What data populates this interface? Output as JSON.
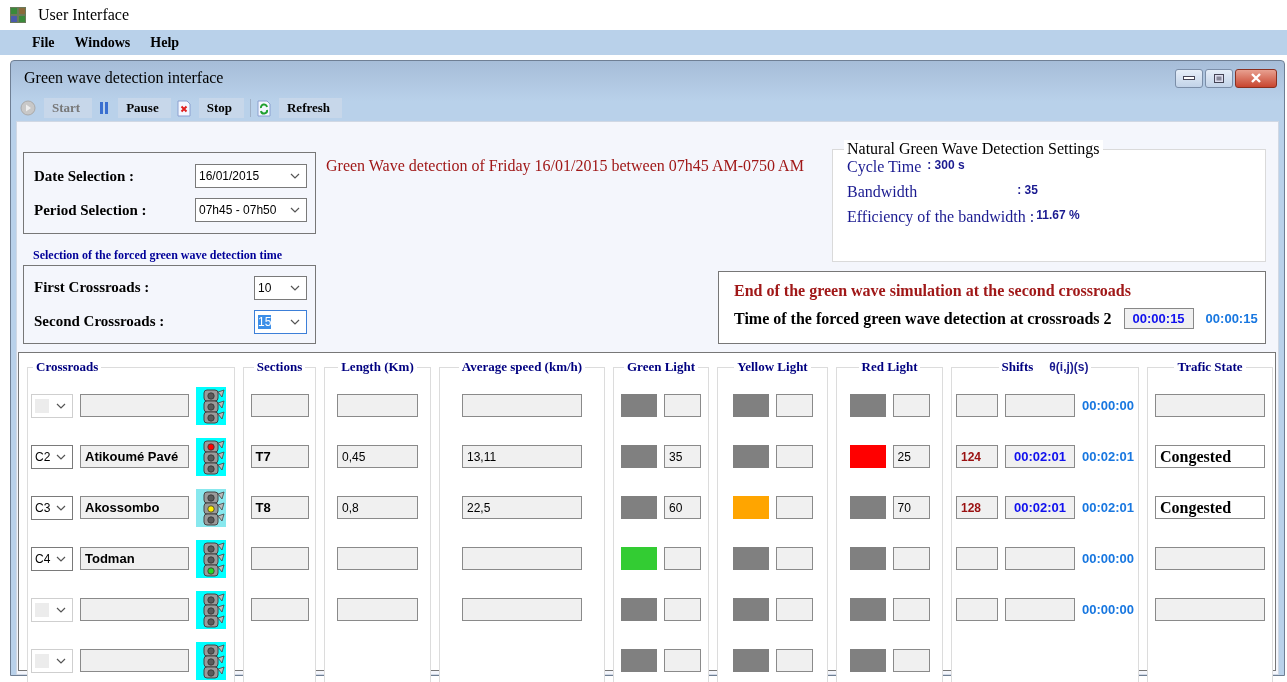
{
  "app": {
    "title": "User Interface"
  },
  "menu": [
    "File",
    "Windows",
    "Help"
  ],
  "child_window": {
    "title": "Green wave detection interface"
  },
  "toolbar": [
    {
      "label": "Start",
      "kind": "start",
      "disabled": true
    },
    {
      "label": "Pause",
      "kind": "pause",
      "disabled": false
    },
    {
      "label": "Stop",
      "kind": "stop",
      "disabled": false
    },
    {
      "label": "Refresh",
      "kind": "refresh",
      "disabled": false
    }
  ],
  "selection": {
    "fields": [
      {
        "label": "Date Selection :",
        "value": "16/01/2015"
      },
      {
        "label": "Period Selection :",
        "value": "07h45 - 07h50"
      }
    ]
  },
  "forced": {
    "title": "Selection of the forced green wave detection time",
    "fields": [
      {
        "label": "First Crossroads :",
        "value": "10",
        "focused": false
      },
      {
        "label": "Second Crossroads :",
        "value": "15",
        "focused": true
      }
    ]
  },
  "headline": "Green Wave detection of Friday 16/01/2015 between 07h45 AM-0750 AM",
  "settings": {
    "title": "Natural Green Wave Detection Settings",
    "rows": [
      {
        "label": "Cycle Time",
        "value": ": 300 s"
      },
      {
        "label": "Bandwidth",
        "value": ": 35"
      },
      {
        "label": "Efficiency of the bandwidth :",
        "value": "11.67 %"
      }
    ]
  },
  "simulation_end": {
    "title": "End of the green wave simulation at the second crossroads",
    "label": "Time of the forced green wave detection at crossroads 2",
    "value": "00:00:15",
    "reading": "00:00:15"
  },
  "table": {
    "columns": [
      {
        "kind": "crossroads",
        "label": "Crossroads",
        "cells": [
          {
            "enabled": false,
            "kind": "dark"
          },
          {
            "enabled": true,
            "code": "C2",
            "name": "Atikoumé Pavé",
            "kind": "red"
          },
          {
            "enabled": true,
            "code": "C3",
            "name": "Akossombo",
            "kind": "yellow"
          },
          {
            "enabled": true,
            "code": "C4",
            "name": "Todman",
            "kind": "green"
          },
          {
            "enabled": false,
            "kind": "dark"
          },
          {
            "enabled": false,
            "kind": "dark"
          }
        ]
      },
      {
        "kind": "text",
        "label": "Sections",
        "bold": true,
        "cells": [
          {},
          {
            "value": "T7"
          },
          {
            "value": "T8"
          },
          {},
          {}
        ]
      },
      {
        "kind": "text",
        "label": "Length (Km)",
        "bold": false,
        "cells": [
          {},
          {
            "value": "0,45"
          },
          {
            "value": "0,8"
          },
          {},
          {}
        ]
      },
      {
        "kind": "text",
        "label": "Average speed (km/h)",
        "bold": false,
        "cells": [
          {},
          {
            "value": "13,11"
          },
          {
            "value": "22,5"
          },
          {},
          {}
        ]
      },
      {
        "kind": "light",
        "label": "Green Light",
        "color": "#33cc33",
        "cells": [
          {
            "on": false
          },
          {
            "on": false,
            "value": "35"
          },
          {
            "on": false,
            "value": "60"
          },
          {
            "on": true
          },
          {
            "on": false
          },
          {
            "on": false
          }
        ]
      },
      {
        "kind": "light",
        "label": "Yellow Light",
        "color": "#ffa500",
        "cells": [
          {
            "on": false
          },
          {
            "on": false
          },
          {
            "on": true
          },
          {
            "on": false
          },
          {
            "on": false
          },
          {
            "on": false
          }
        ]
      },
      {
        "kind": "light",
        "label": "Red Light",
        "color": "#ff0000",
        "cells": [
          {
            "on": false
          },
          {
            "on": true,
            "value": "25"
          },
          {
            "on": false,
            "value": "70"
          },
          {
            "on": false
          },
          {
            "on": false
          },
          {
            "on": false
          }
        ]
      },
      {
        "kind": "shift",
        "label": "Shifts",
        "sub": "θ(i,j)(s)",
        "cells": [
          {
            "reading": "00:00:00"
          },
          {
            "shift": "124",
            "time": "00:02:01",
            "reading": "00:02:01"
          },
          {
            "shift": "128",
            "time": "00:02:01",
            "reading": "00:02:01"
          },
          {
            "reading": "00:00:00"
          },
          {
            "reading": "00:00:00"
          }
        ]
      },
      {
        "kind": "state",
        "label": "Trafic State",
        "cells": [
          {},
          {
            "value": "Congested"
          },
          {
            "value": "Congested"
          },
          {},
          {}
        ]
      }
    ]
  }
}
